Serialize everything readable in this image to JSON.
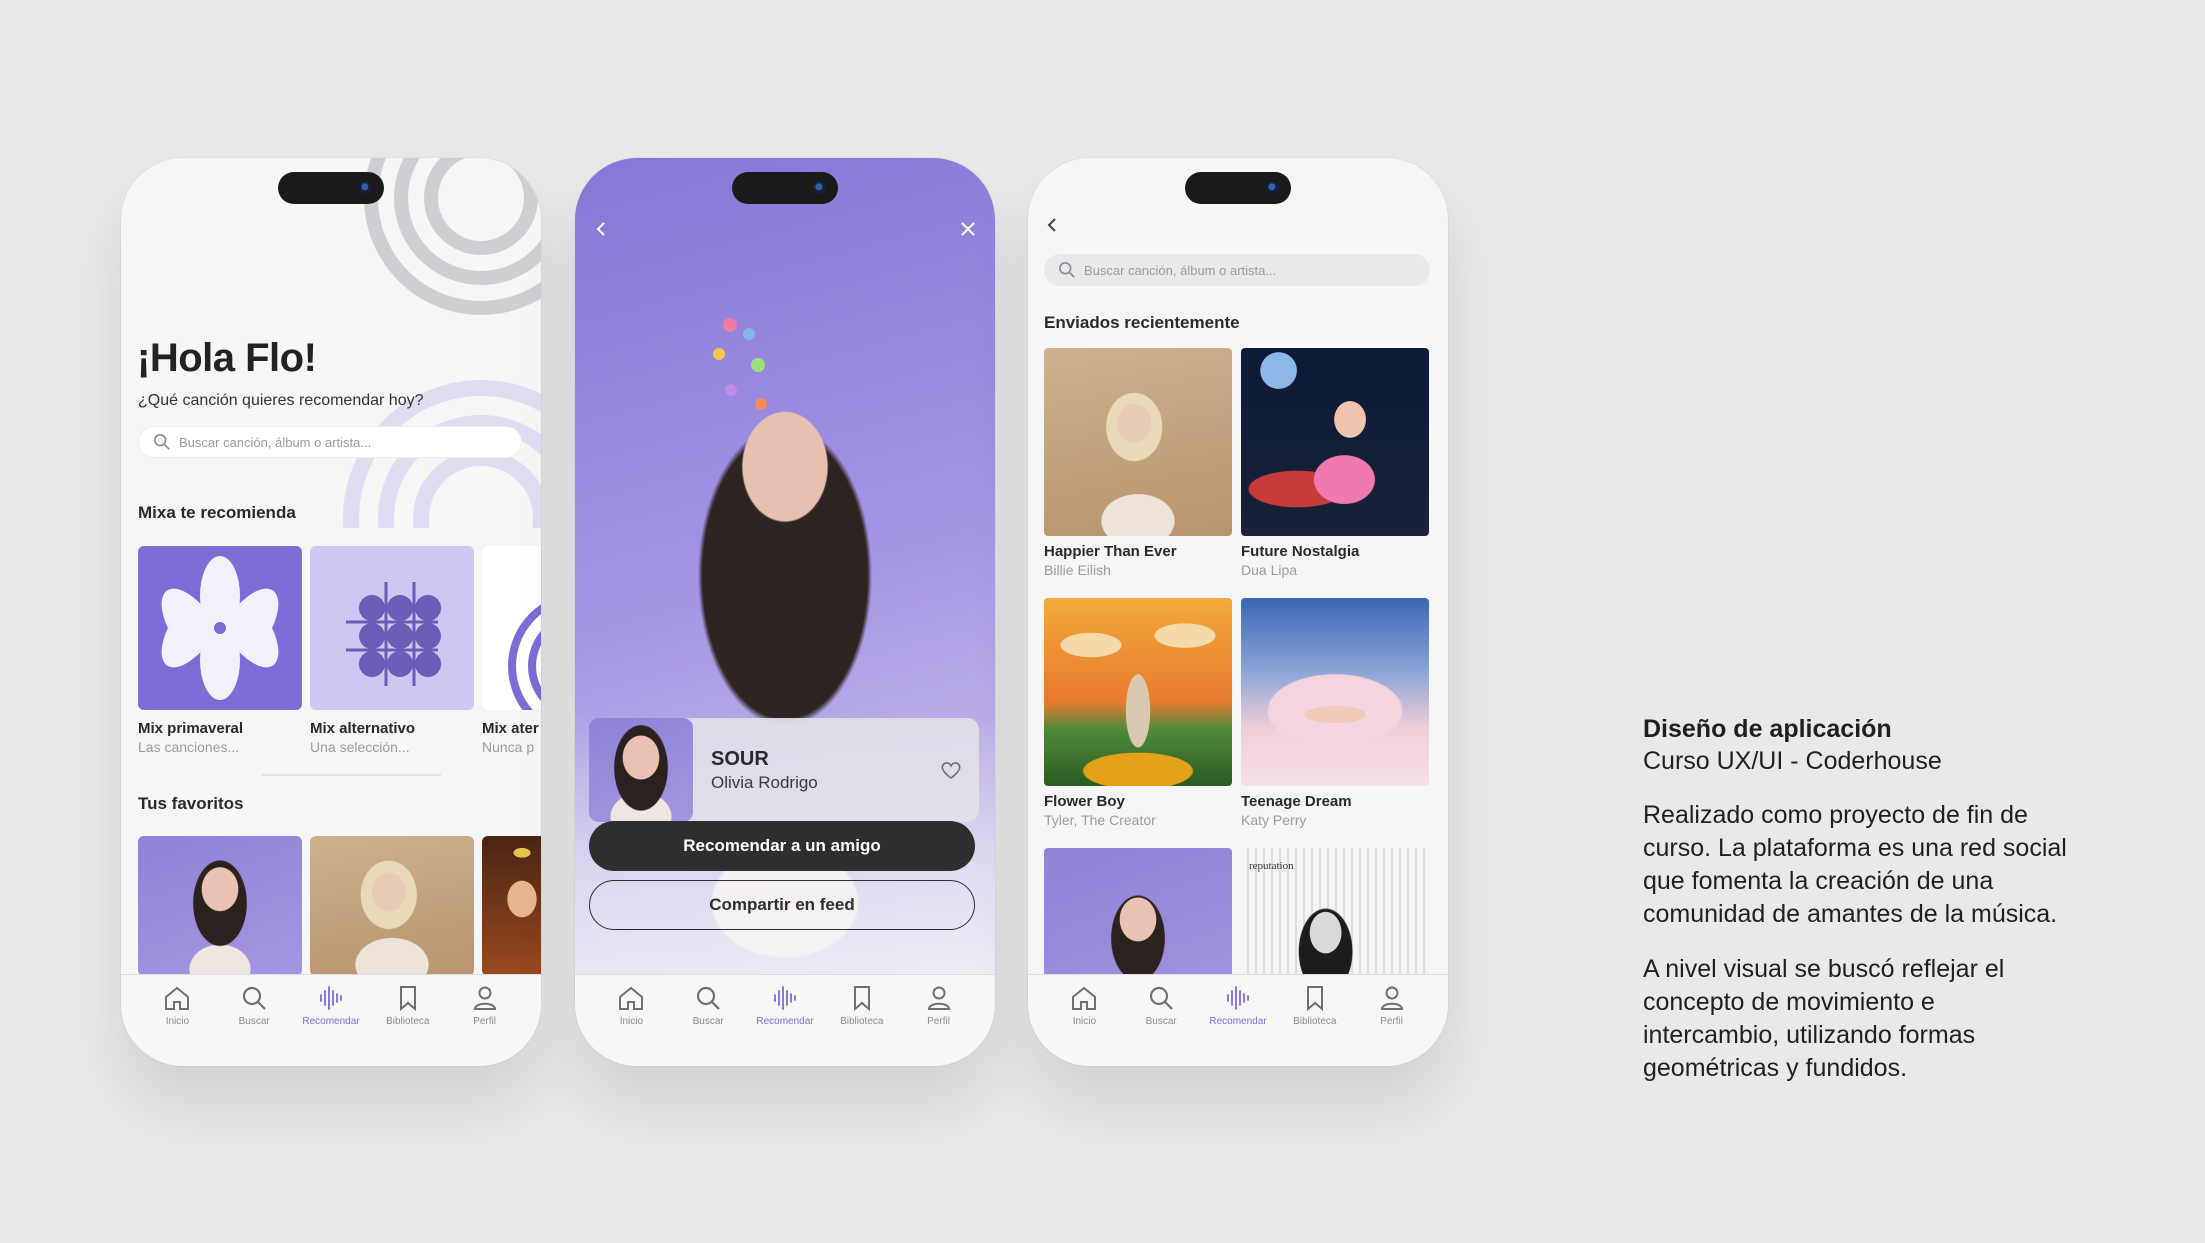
{
  "tabs": [
    {
      "label": "Inicio",
      "icon": "home-icon"
    },
    {
      "label": "Buscar",
      "icon": "search-icon"
    },
    {
      "label": "Recomendar",
      "icon": "soundwave-icon"
    },
    {
      "label": "Biblioteca",
      "icon": "bookmark-icon"
    },
    {
      "label": "Perfil",
      "icon": "user-icon"
    }
  ],
  "colors": {
    "accent": "#7f6bd6",
    "lavender": "#a596e0",
    "dark": "#2e2e30"
  },
  "home": {
    "greeting": "¡Hola Flo!",
    "question": "¿Qué canción quieres recomendar hoy?",
    "search_placeholder": "Buscar canción, álbum o artista...",
    "mix_section": "Mixa te recomienda",
    "mixes": [
      {
        "title": "Mix primaveral",
        "subtitle": "Las canciones..."
      },
      {
        "title": "Mix alternativo",
        "subtitle": "Una selección..."
      },
      {
        "title": "Mix ater",
        "subtitle": "Nunca p"
      }
    ],
    "favs_section": "Tus favoritos"
  },
  "player": {
    "song": "SOUR",
    "artist": "Olivia Rodrigo",
    "primary_button": "Recomendar a un amigo",
    "secondary_button": "Compartir en feed"
  },
  "search": {
    "placeholder": "Buscar canción, álbum o artista...",
    "section": "Enviados recientemente",
    "albums": [
      {
        "title": "Happier Than Ever",
        "artist": "Billie Eilish"
      },
      {
        "title": "Future Nostalgia",
        "artist": "Dua Lipa"
      },
      {
        "title": "Flower Boy",
        "artist": "Tyler, The Creator"
      },
      {
        "title": "Teenage Dream",
        "artist": "Katy Perry"
      },
      {
        "title": "",
        "artist": ""
      },
      {
        "title": "",
        "artist": ""
      }
    ]
  },
  "caption": {
    "title": "Diseño de aplicación",
    "subtitle": "Curso UX/UI - Coderhouse",
    "paragraph1": "Realizado como proyecto de fin de curso. La plataforma es una red social que fomenta la creación de una comunidad de amantes de la música.",
    "paragraph2": "A nivel visual se buscó reflejar el concepto de movimiento e intercambio, utilizando formas geométricas y fundidos.",
    "album_art_text": "reputation"
  }
}
